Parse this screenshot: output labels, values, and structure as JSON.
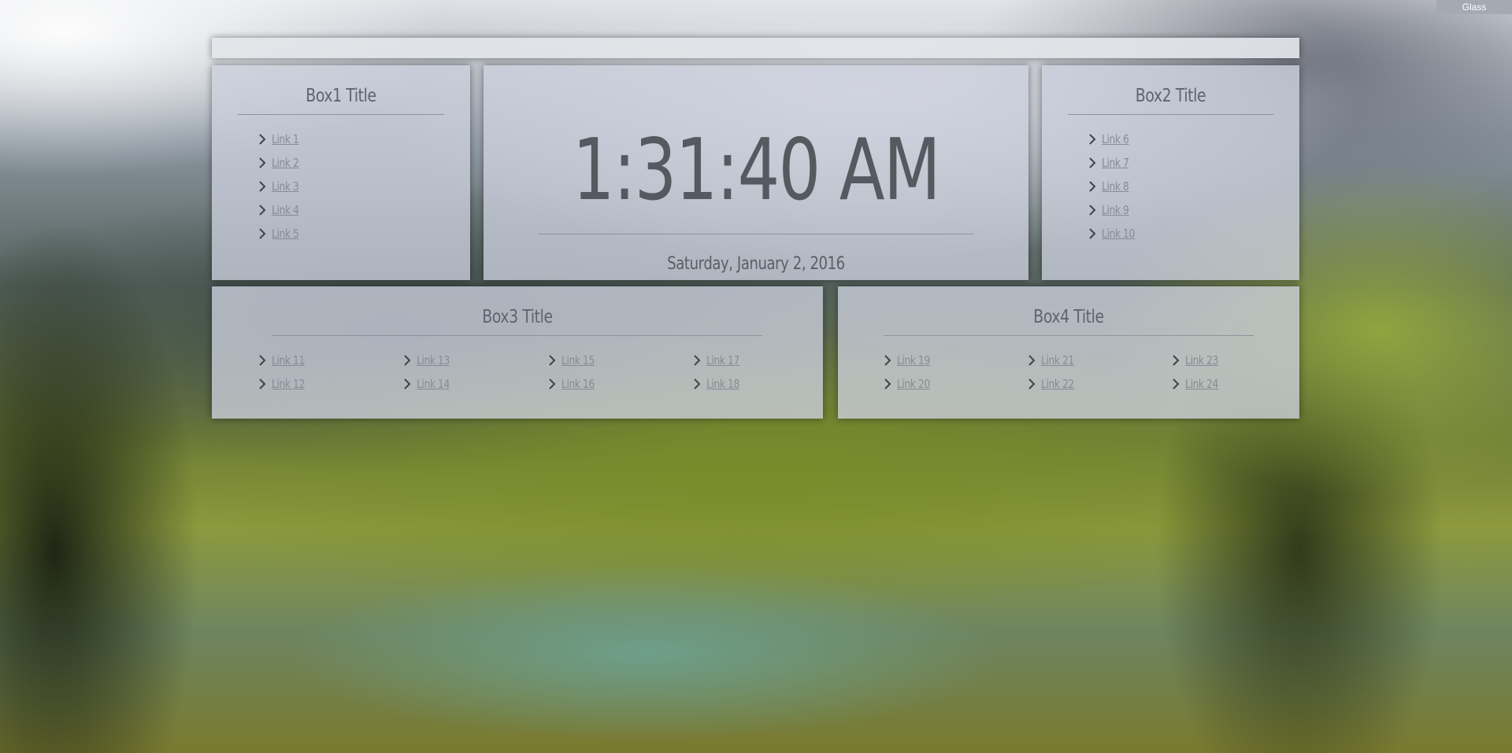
{
  "theme_label": "Glass",
  "box1": {
    "title": "Box1 Title",
    "links": [
      "Link 1",
      "Link 2",
      "Link 3",
      "Link 4",
      "Link 5"
    ]
  },
  "clock": {
    "time": "1:31:40 AM",
    "date": "Saturday, January 2, 2016"
  },
  "box2": {
    "title": "Box2 Title",
    "links": [
      "Link 6",
      "Link 7",
      "Link 8",
      "Link 9",
      "Link 10"
    ]
  },
  "box3": {
    "title": "Box3 Title",
    "links": [
      "Link 11",
      "Link 12",
      "Link 13",
      "Link 14",
      "Link 15",
      "Link 16",
      "Link 17",
      "Link 18"
    ]
  },
  "box4": {
    "title": "Box4 Title",
    "links": [
      "Link 19",
      "Link 20",
      "Link 21",
      "Link 22",
      "Link 23",
      "Link 24"
    ]
  },
  "icons": {
    "link_bullet": "chevron-right-icon"
  },
  "colors": {
    "panel": "#ccd0dc",
    "text": "#5f6370",
    "link": "#868b97"
  }
}
